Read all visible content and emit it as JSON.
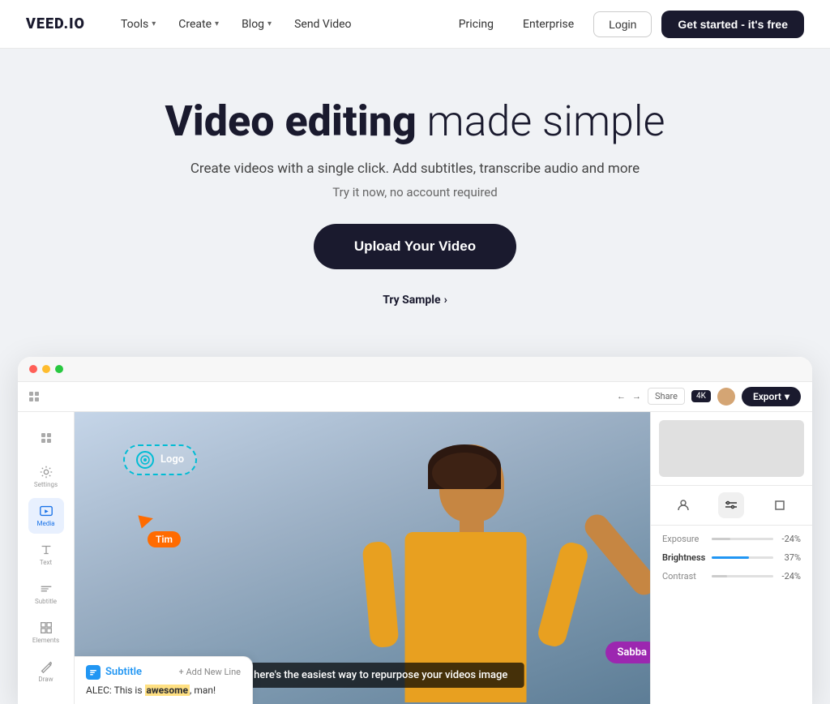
{
  "brand": {
    "name": "VEED.IO"
  },
  "navbar": {
    "tools_label": "Tools",
    "create_label": "Create",
    "blog_label": "Blog",
    "send_video_label": "Send Video",
    "pricing_label": "Pricing",
    "enterprise_label": "Enterprise",
    "login_label": "Login",
    "cta_label": "Get started - it's free"
  },
  "hero": {
    "title_bold": "Video editing",
    "title_light": " made simple",
    "subtitle": "Create videos with a single click. Add subtitles, transcribe audio and more",
    "tagline": "Try it now, no account required",
    "upload_btn": "Upload Your Video",
    "try_sample": "Try Sample",
    "try_sample_arrow": "›"
  },
  "editor_preview": {
    "window_dots": [
      "red",
      "yellow",
      "green"
    ],
    "topbar": {
      "back_arrow": "←",
      "forward_arrow": "→",
      "share_label": "Share",
      "ok_badge": "4K",
      "export_label": "Export",
      "export_arrow": "▾"
    },
    "sidebar_items": [
      {
        "icon": "⋮⋮",
        "label": ""
      },
      {
        "icon": "◎",
        "label": "Settings"
      },
      {
        "icon": "◎",
        "label": "Media",
        "active": true
      },
      {
        "icon": "T",
        "label": "Text"
      },
      {
        "icon": "≡",
        "label": "Subtitle"
      },
      {
        "icon": "◇",
        "label": "Elements"
      },
      {
        "icon": "/",
        "label": "Draw"
      }
    ],
    "canvas": {
      "logo_annotation": "Logo",
      "cursor_name": "Tim",
      "subtitle_bar": "DIANA: here's the easiest way to repurpose your videos image"
    },
    "right_panel": {
      "tabs": [
        "👤",
        "⚙",
        "⬜"
      ],
      "sliders": [
        {
          "label": "Exposure",
          "value": "-24%",
          "fill_pct": 0,
          "color": "#ccc"
        },
        {
          "label": "Brightness",
          "value": "37%",
          "fill_pct": 60,
          "color": "#2196f3"
        },
        {
          "label": "Contrast",
          "value": "-24%",
          "fill_pct": 20,
          "color": "#ccc"
        }
      ]
    },
    "sabba_annotation": "Sabba",
    "subtitle_panel": {
      "label": "Subtitle",
      "add_line": "+ Add New Line",
      "text_line": "ALEC: This is ",
      "text_bold": "awesome",
      "text_end": ", man!"
    }
  }
}
